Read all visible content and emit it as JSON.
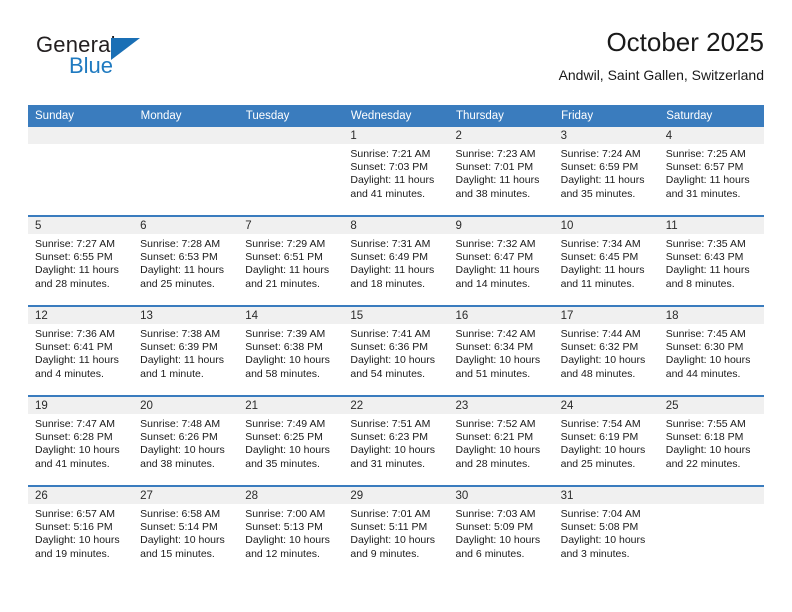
{
  "brand": {
    "name_top": "General",
    "name_bottom": "Blue",
    "color_dark": "#231f20",
    "color_blue": "#1f7ac0"
  },
  "header": {
    "title": "October 2025",
    "subtitle": "Andwil, Saint Gallen, Switzerland"
  },
  "theme": {
    "header_bg": "#3a7cbe",
    "date_band_bg": "#f0f0f0",
    "text": "#1a1a1a"
  },
  "weekday_headers": [
    "Sunday",
    "Monday",
    "Tuesday",
    "Wednesday",
    "Thursday",
    "Friday",
    "Saturday"
  ],
  "labels": {
    "sunrise": "Sunrise:",
    "sunset": "Sunset:",
    "daylight": "Daylight:"
  },
  "weeks": [
    [
      {
        "day": ""
      },
      {
        "day": ""
      },
      {
        "day": ""
      },
      {
        "day": "1",
        "sunrise": "Sunrise: 7:21 AM",
        "sunset": "Sunset: 7:03 PM",
        "daylight_1": "Daylight: 11 hours",
        "daylight_2": "and 41 minutes."
      },
      {
        "day": "2",
        "sunrise": "Sunrise: 7:23 AM",
        "sunset": "Sunset: 7:01 PM",
        "daylight_1": "Daylight: 11 hours",
        "daylight_2": "and 38 minutes."
      },
      {
        "day": "3",
        "sunrise": "Sunrise: 7:24 AM",
        "sunset": "Sunset: 6:59 PM",
        "daylight_1": "Daylight: 11 hours",
        "daylight_2": "and 35 minutes."
      },
      {
        "day": "4",
        "sunrise": "Sunrise: 7:25 AM",
        "sunset": "Sunset: 6:57 PM",
        "daylight_1": "Daylight: 11 hours",
        "daylight_2": "and 31 minutes."
      }
    ],
    [
      {
        "day": "5",
        "sunrise": "Sunrise: 7:27 AM",
        "sunset": "Sunset: 6:55 PM",
        "daylight_1": "Daylight: 11 hours",
        "daylight_2": "and 28 minutes."
      },
      {
        "day": "6",
        "sunrise": "Sunrise: 7:28 AM",
        "sunset": "Sunset: 6:53 PM",
        "daylight_1": "Daylight: 11 hours",
        "daylight_2": "and 25 minutes."
      },
      {
        "day": "7",
        "sunrise": "Sunrise: 7:29 AM",
        "sunset": "Sunset: 6:51 PM",
        "daylight_1": "Daylight: 11 hours",
        "daylight_2": "and 21 minutes."
      },
      {
        "day": "8",
        "sunrise": "Sunrise: 7:31 AM",
        "sunset": "Sunset: 6:49 PM",
        "daylight_1": "Daylight: 11 hours",
        "daylight_2": "and 18 minutes."
      },
      {
        "day": "9",
        "sunrise": "Sunrise: 7:32 AM",
        "sunset": "Sunset: 6:47 PM",
        "daylight_1": "Daylight: 11 hours",
        "daylight_2": "and 14 minutes."
      },
      {
        "day": "10",
        "sunrise": "Sunrise: 7:34 AM",
        "sunset": "Sunset: 6:45 PM",
        "daylight_1": "Daylight: 11 hours",
        "daylight_2": "and 11 minutes."
      },
      {
        "day": "11",
        "sunrise": "Sunrise: 7:35 AM",
        "sunset": "Sunset: 6:43 PM",
        "daylight_1": "Daylight: 11 hours",
        "daylight_2": "and 8 minutes."
      }
    ],
    [
      {
        "day": "12",
        "sunrise": "Sunrise: 7:36 AM",
        "sunset": "Sunset: 6:41 PM",
        "daylight_1": "Daylight: 11 hours",
        "daylight_2": "and 4 minutes."
      },
      {
        "day": "13",
        "sunrise": "Sunrise: 7:38 AM",
        "sunset": "Sunset: 6:39 PM",
        "daylight_1": "Daylight: 11 hours",
        "daylight_2": "and 1 minute."
      },
      {
        "day": "14",
        "sunrise": "Sunrise: 7:39 AM",
        "sunset": "Sunset: 6:38 PM",
        "daylight_1": "Daylight: 10 hours",
        "daylight_2": "and 58 minutes."
      },
      {
        "day": "15",
        "sunrise": "Sunrise: 7:41 AM",
        "sunset": "Sunset: 6:36 PM",
        "daylight_1": "Daylight: 10 hours",
        "daylight_2": "and 54 minutes."
      },
      {
        "day": "16",
        "sunrise": "Sunrise: 7:42 AM",
        "sunset": "Sunset: 6:34 PM",
        "daylight_1": "Daylight: 10 hours",
        "daylight_2": "and 51 minutes."
      },
      {
        "day": "17",
        "sunrise": "Sunrise: 7:44 AM",
        "sunset": "Sunset: 6:32 PM",
        "daylight_1": "Daylight: 10 hours",
        "daylight_2": "and 48 minutes."
      },
      {
        "day": "18",
        "sunrise": "Sunrise: 7:45 AM",
        "sunset": "Sunset: 6:30 PM",
        "daylight_1": "Daylight: 10 hours",
        "daylight_2": "and 44 minutes."
      }
    ],
    [
      {
        "day": "19",
        "sunrise": "Sunrise: 7:47 AM",
        "sunset": "Sunset: 6:28 PM",
        "daylight_1": "Daylight: 10 hours",
        "daylight_2": "and 41 minutes."
      },
      {
        "day": "20",
        "sunrise": "Sunrise: 7:48 AM",
        "sunset": "Sunset: 6:26 PM",
        "daylight_1": "Daylight: 10 hours",
        "daylight_2": "and 38 minutes."
      },
      {
        "day": "21",
        "sunrise": "Sunrise: 7:49 AM",
        "sunset": "Sunset: 6:25 PM",
        "daylight_1": "Daylight: 10 hours",
        "daylight_2": "and 35 minutes."
      },
      {
        "day": "22",
        "sunrise": "Sunrise: 7:51 AM",
        "sunset": "Sunset: 6:23 PM",
        "daylight_1": "Daylight: 10 hours",
        "daylight_2": "and 31 minutes."
      },
      {
        "day": "23",
        "sunrise": "Sunrise: 7:52 AM",
        "sunset": "Sunset: 6:21 PM",
        "daylight_1": "Daylight: 10 hours",
        "daylight_2": "and 28 minutes."
      },
      {
        "day": "24",
        "sunrise": "Sunrise: 7:54 AM",
        "sunset": "Sunset: 6:19 PM",
        "daylight_1": "Daylight: 10 hours",
        "daylight_2": "and 25 minutes."
      },
      {
        "day": "25",
        "sunrise": "Sunrise: 7:55 AM",
        "sunset": "Sunset: 6:18 PM",
        "daylight_1": "Daylight: 10 hours",
        "daylight_2": "and 22 minutes."
      }
    ],
    [
      {
        "day": "26",
        "sunrise": "Sunrise: 6:57 AM",
        "sunset": "Sunset: 5:16 PM",
        "daylight_1": "Daylight: 10 hours",
        "daylight_2": "and 19 minutes."
      },
      {
        "day": "27",
        "sunrise": "Sunrise: 6:58 AM",
        "sunset": "Sunset: 5:14 PM",
        "daylight_1": "Daylight: 10 hours",
        "daylight_2": "and 15 minutes."
      },
      {
        "day": "28",
        "sunrise": "Sunrise: 7:00 AM",
        "sunset": "Sunset: 5:13 PM",
        "daylight_1": "Daylight: 10 hours",
        "daylight_2": "and 12 minutes."
      },
      {
        "day": "29",
        "sunrise": "Sunrise: 7:01 AM",
        "sunset": "Sunset: 5:11 PM",
        "daylight_1": "Daylight: 10 hours",
        "daylight_2": "and 9 minutes."
      },
      {
        "day": "30",
        "sunrise": "Sunrise: 7:03 AM",
        "sunset": "Sunset: 5:09 PM",
        "daylight_1": "Daylight: 10 hours",
        "daylight_2": "and 6 minutes."
      },
      {
        "day": "31",
        "sunrise": "Sunrise: 7:04 AM",
        "sunset": "Sunset: 5:08 PM",
        "daylight_1": "Daylight: 10 hours",
        "daylight_2": "and 3 minutes."
      },
      {
        "day": ""
      }
    ]
  ]
}
